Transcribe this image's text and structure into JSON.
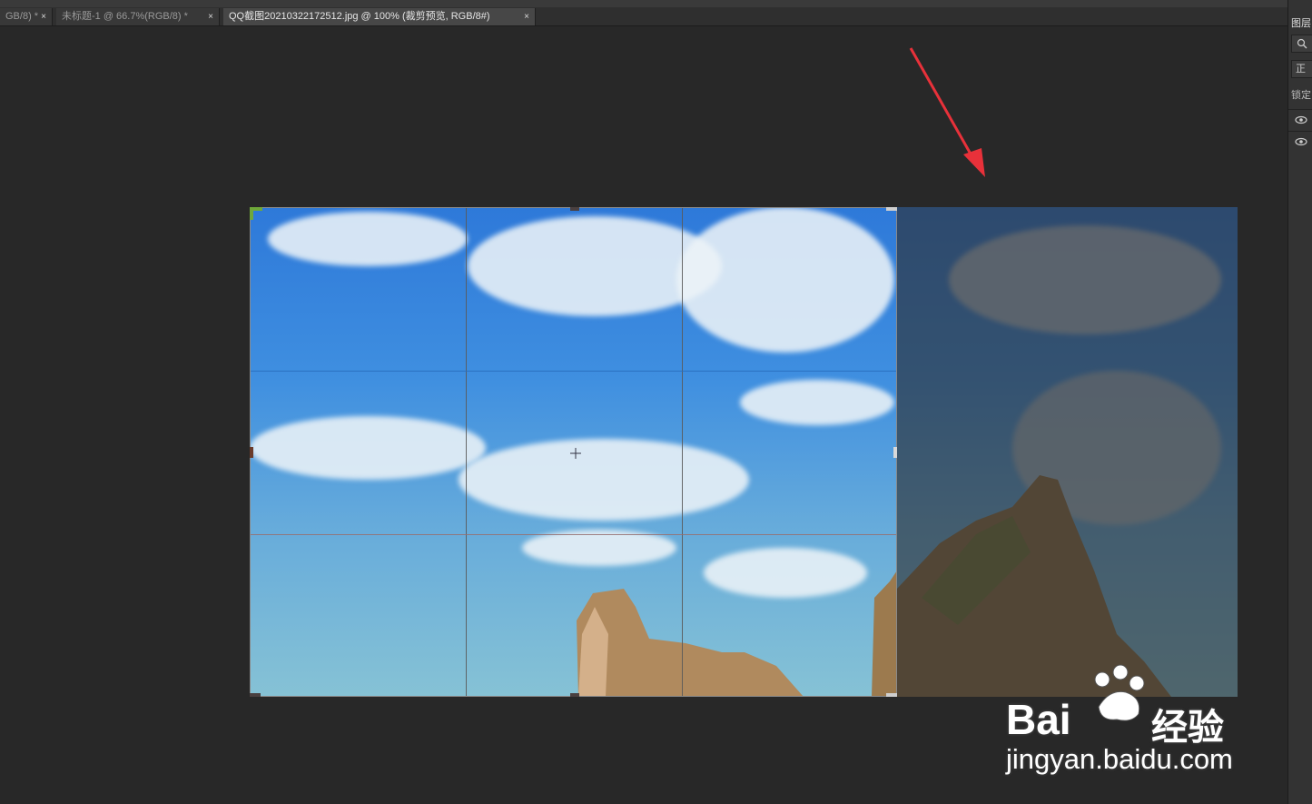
{
  "tabs": [
    {
      "label": "GB/8) *",
      "close": "×"
    },
    {
      "label": "未标题-1 @ 66.7%(RGB/8) *",
      "close": "×"
    },
    {
      "label": "QQ截图20210322172512.jpg @ 100% (裁剪预览, RGB/8#)",
      "close": "×"
    }
  ],
  "layers_panel": {
    "title": "图层",
    "blend_mode": "正常",
    "lock_label": "锁定"
  },
  "icons": {
    "search": "search-icon",
    "visibility": "eye-icon",
    "annotation": "red-arrow-icon",
    "watermark": "baidu-paw-logo"
  },
  "watermark": {
    "brand": "Bai",
    "brand2": "经验",
    "url": "jingyan.baidu.com"
  },
  "colors": {
    "annotation_arrow": "#e8313a",
    "crop_grid": "#8a8a8a",
    "canvas_bg": "#282828"
  }
}
